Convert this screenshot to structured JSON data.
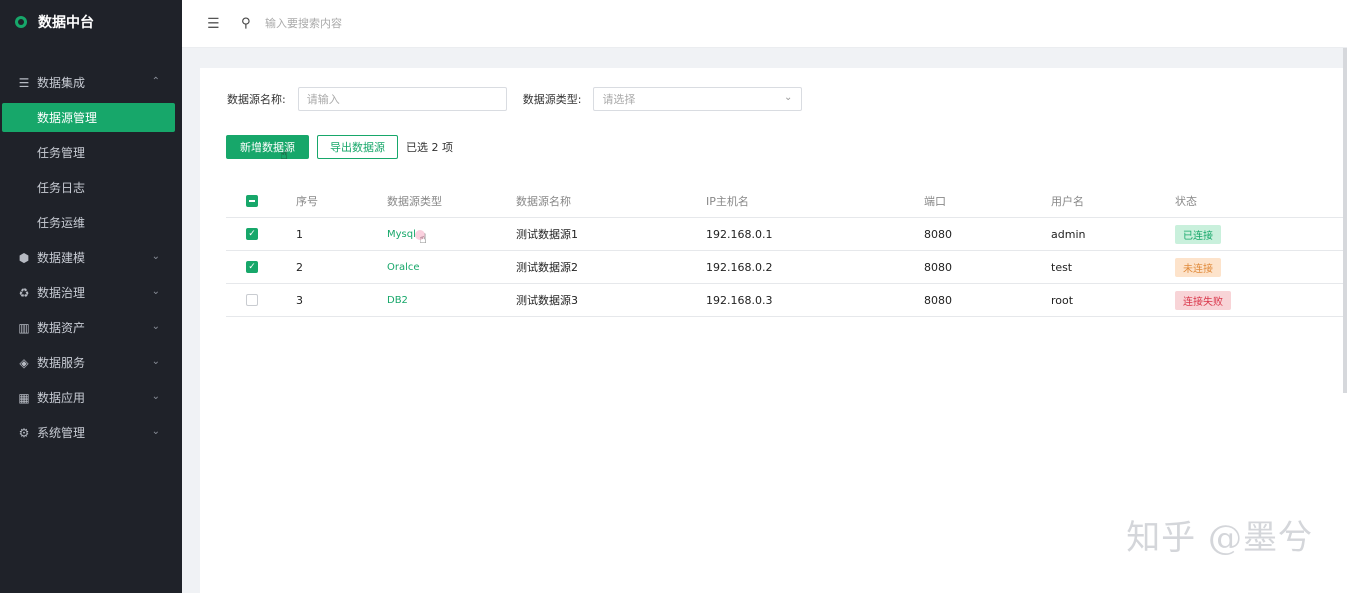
{
  "app": {
    "title": "数据中台"
  },
  "sidebar": {
    "groups": [
      {
        "label": "数据集成",
        "icon": "database-icon",
        "expanded": true,
        "children": [
          "数据源管理",
          "任务管理",
          "任务日志",
          "任务运维"
        ]
      },
      {
        "label": "数据建模",
        "icon": "cubes-icon"
      },
      {
        "label": "数据治理",
        "icon": "recycle-icon"
      },
      {
        "label": "数据资产",
        "icon": "barcode-icon"
      },
      {
        "label": "数据服务",
        "icon": "box-icon"
      },
      {
        "label": "数据应用",
        "icon": "apps-grid-icon"
      },
      {
        "label": "系统管理",
        "icon": "gear-icon"
      }
    ],
    "active_child": "数据源管理"
  },
  "topbar": {
    "search_placeholder": "输入要搜索内容"
  },
  "filters": {
    "name_label": "数据源名称:",
    "name_placeholder": "请输入",
    "type_label": "数据源类型:",
    "type_placeholder": "请选择"
  },
  "actions": {
    "add_label": "新增数据源",
    "export_label": "导出数据源",
    "selected_text": "已选 2 项"
  },
  "table": {
    "headers": [
      "序号",
      "数据源类型",
      "数据源名称",
      "IP主机名",
      "端口",
      "用户名",
      "状态"
    ],
    "rows": [
      {
        "checked": true,
        "no": "1",
        "type": "Mysql",
        "name": "测试数据源1",
        "ip": "192.168.0.1",
        "port": "8080",
        "user": "admin",
        "status": "已连接",
        "status_kind": "ok"
      },
      {
        "checked": true,
        "no": "2",
        "type": "Oralce",
        "name": "测试数据源2",
        "ip": "192.168.0.2",
        "port": "8080",
        "user": "test",
        "status": "未连接",
        "status_kind": "wait"
      },
      {
        "checked": false,
        "no": "3",
        "type": "DB2",
        "name": "测试数据源3",
        "ip": "192.168.0.3",
        "port": "8080",
        "user": "root",
        "status": "连接失败",
        "status_kind": "fail"
      }
    ]
  },
  "watermark": "知乎 @墨兮",
  "colors": {
    "accent": "#17a76a",
    "sidebar_bg": "#1f2229"
  }
}
